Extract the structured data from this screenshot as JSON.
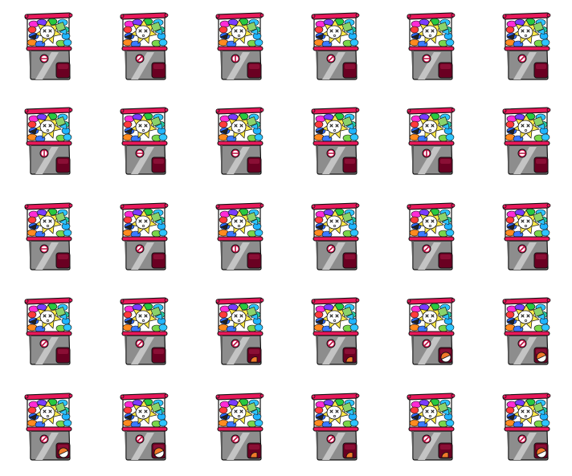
{
  "sprite_sheet": {
    "rows": 5,
    "columns": 6,
    "subject": "gachapon-capsule-machine",
    "colors": {
      "outline": "#111111",
      "frame_red": "#e8195a",
      "frame_red_dark": "#b5103f",
      "body_gray": "#8d8d8d",
      "body_gray_light": "#c4c4c4",
      "slot_dark": "#6a0022",
      "coin_white": "#ffffff",
      "capsule_orange": "#f07a2a",
      "capsule_white": "#ffffff",
      "star_yellow": "#ffe94a",
      "face_white": "#ffffff"
    },
    "frames": [
      {
        "knob": "horizontal",
        "capsule": "none"
      },
      {
        "knob": "diagonal",
        "capsule": "none"
      },
      {
        "knob": "vertical",
        "capsule": "none"
      },
      {
        "knob": "diagonal",
        "capsule": "none"
      },
      {
        "knob": "horizontal",
        "capsule": "none"
      },
      {
        "knob": "diagonal",
        "capsule": "none"
      },
      {
        "knob": "vertical",
        "capsule": "none"
      },
      {
        "knob": "horizontal",
        "capsule": "none"
      },
      {
        "knob": "horizontal",
        "capsule": "none"
      },
      {
        "knob": "horizontal",
        "capsule": "none"
      },
      {
        "knob": "vertical",
        "capsule": "none"
      },
      {
        "knob": "horizontal",
        "capsule": "none"
      },
      {
        "knob": "horizontal",
        "capsule": "none"
      },
      {
        "knob": "diagonal",
        "capsule": "none"
      },
      {
        "knob": "vertical",
        "capsule": "none"
      },
      {
        "knob": "diagonal",
        "capsule": "none"
      },
      {
        "knob": "diagonal",
        "capsule": "none"
      },
      {
        "knob": "diagonal",
        "capsule": "none"
      },
      {
        "knob": "diagonal",
        "capsule": "none"
      },
      {
        "knob": "diagonal",
        "capsule": "none"
      },
      {
        "knob": "diagonal",
        "capsule": "partial"
      },
      {
        "knob": "diagonal",
        "capsule": "partial"
      },
      {
        "knob": "diagonal",
        "capsule": "full"
      },
      {
        "knob": "diagonal",
        "capsule": "full"
      },
      {
        "knob": "diagonal",
        "capsule": "full"
      },
      {
        "knob": "diagonal",
        "capsule": "full"
      },
      {
        "knob": "diagonal",
        "capsule": "partial"
      },
      {
        "knob": "diagonal",
        "capsule": "partial"
      },
      {
        "knob": "diagonal",
        "capsule": "partial"
      },
      {
        "knob": "diagonal",
        "capsule": "full"
      }
    ]
  }
}
